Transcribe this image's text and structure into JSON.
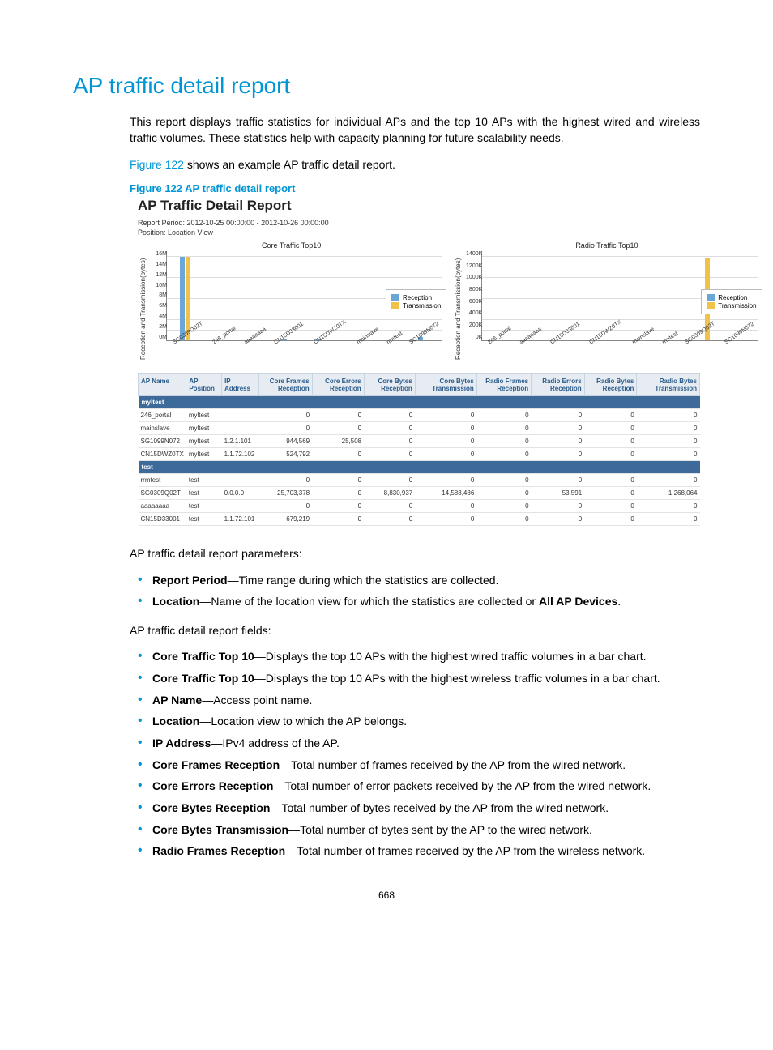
{
  "heading": "AP traffic detail report",
  "intro": "This report displays traffic statistics for individual APs and the top 10 APs with the highest wired and wireless traffic volumes. These statistics help with capacity planning for future scalability needs.",
  "figure_ref_link": "Figure 122",
  "figure_ref_tail": " shows an example AP traffic detail report.",
  "figure_caption": "Figure 122 AP traffic detail report",
  "shot": {
    "title": "AP Traffic Detail Report",
    "report_period": "Report Period: 2012-10-25 00:00:00  -  2012-10-26 00:00:00",
    "position": "Position: Location View",
    "legend_rx": "Reception",
    "legend_tx": "Transmission",
    "columns": [
      "AP Name",
      "AP Position",
      "IP Address",
      "Core Frames Reception",
      "Core Errors Reception",
      "Core Bytes Reception",
      "Core Bytes Transmission",
      "Radio Frames Reception",
      "Radio Errors Reception",
      "Radio Bytes Reception",
      "Radio Bytes Transmission"
    ],
    "groups": [
      {
        "name": "myltest",
        "rows": [
          {
            "ap": "246_portal",
            "pos": "myltest",
            "ip": "",
            "v": [
              "0",
              "0",
              "0",
              "0",
              "0",
              "0",
              "0",
              "0"
            ]
          },
          {
            "ap": "mainslave",
            "pos": "myltest",
            "ip": "",
            "v": [
              "0",
              "0",
              "0",
              "0",
              "0",
              "0",
              "0",
              "0"
            ]
          },
          {
            "ap": "SG1099N072",
            "pos": "myltest",
            "ip": "1.2.1.101",
            "v": [
              "944,569",
              "25,508",
              "0",
              "0",
              "0",
              "0",
              "0",
              "0"
            ]
          },
          {
            "ap": "CN15DWZ0TX",
            "pos": "myltest",
            "ip": "1.1.72.102",
            "v": [
              "524,792",
              "0",
              "0",
              "0",
              "0",
              "0",
              "0",
              "0"
            ]
          }
        ]
      },
      {
        "name": "test",
        "rows": [
          {
            "ap": "rrmtest",
            "pos": "test",
            "ip": "",
            "v": [
              "0",
              "0",
              "0",
              "0",
              "0",
              "0",
              "0",
              "0"
            ]
          },
          {
            "ap": "SG0309Q02T",
            "pos": "test",
            "ip": "0.0.0.0",
            "v": [
              "25,703,378",
              "0",
              "8,830,937",
              "14,588,486",
              "0",
              "53,591",
              "0",
              "1,268,064"
            ]
          },
          {
            "ap": "aaaaaaaa",
            "pos": "test",
            "ip": "",
            "v": [
              "0",
              "0",
              "0",
              "0",
              "0",
              "0",
              "0",
              "0"
            ]
          },
          {
            "ap": "CN15D33001",
            "pos": "test",
            "ip": "1.1.72.101",
            "v": [
              "679,219",
              "0",
              "0",
              "0",
              "0",
              "0",
              "0",
              "0"
            ]
          }
        ]
      }
    ]
  },
  "chart_data": [
    {
      "type": "bar",
      "title": "Core Traffic Top10",
      "ylabel": "Reception and Transmission(bytes)",
      "yticks": [
        "0M",
        "2M",
        "4M",
        "6M",
        "8M",
        "10M",
        "12M",
        "14M",
        "16M"
      ],
      "categories": [
        "SG0309Q02T",
        "246_portal",
        "aaaaaaaa",
        "CN15D33001",
        "CN15DWZ0TX",
        "mainslave",
        "rrmtest",
        "SG1099N072"
      ],
      "series": [
        {
          "name": "Reception",
          "values": [
            15,
            0,
            0,
            0.3,
            0.3,
            0,
            0,
            0.5
          ]
        },
        {
          "name": "Transmission",
          "values": [
            15,
            0,
            0,
            0,
            0,
            0,
            0,
            0
          ]
        }
      ],
      "ylim": [
        0,
        16
      ]
    },
    {
      "type": "bar",
      "title": "Radio Traffic Top10",
      "ylabel": "Reception and Transmission(bytes)",
      "yticks": [
        "0K",
        "200K",
        "400K",
        "600K",
        "800K",
        "1000K",
        "1200K",
        "1400K"
      ],
      "categories": [
        "246_portal",
        "aaaaaaaa",
        "CN15D33001",
        "CN15DWZ0TX",
        "mainslave",
        "rrmtest",
        "SG0309Q02T",
        "SG1099N072"
      ],
      "series": [
        {
          "name": "Reception",
          "values": [
            0,
            0,
            0,
            0,
            0,
            0,
            0,
            0
          ]
        },
        {
          "name": "Transmission",
          "values": [
            0,
            0,
            0,
            0,
            0,
            0,
            1300,
            0
          ]
        }
      ],
      "ylim": [
        0,
        1400
      ]
    }
  ],
  "params_intro": "AP traffic detail report parameters:",
  "params": [
    {
      "b": "Report Period",
      "t": "—Time range during which the statistics are collected."
    },
    {
      "b": "Location",
      "t": "—Name of the location view for which the statistics are collected or ",
      "b2": "All AP Devices",
      "t2": "."
    }
  ],
  "fields_intro": "AP traffic detail report fields:",
  "fields": [
    {
      "b": "Core Traffic Top 10",
      "t": "—Displays the top 10 APs with the highest wired traffic volumes in a bar chart."
    },
    {
      "b": "Core Traffic Top 10",
      "t": "—Displays the top 10 APs with the highest wireless traffic volumes in a bar chart."
    },
    {
      "b": "AP Name",
      "t": "—Access point name."
    },
    {
      "b": "Location",
      "t": "—Location view to which the AP belongs."
    },
    {
      "b": "IP Address",
      "t": "—IPv4 address of the AP."
    },
    {
      "b": "Core Frames Reception",
      "t": "—Total number of frames received by the AP from the wired network."
    },
    {
      "b": "Core Errors Reception",
      "t": "—Total number of error packets received by the AP from the wired network."
    },
    {
      "b": "Core Bytes Reception",
      "t": "—Total number of bytes received by the AP from the wired network."
    },
    {
      "b": "Core Bytes Transmission",
      "t": "—Total number of bytes sent by the AP to the wired network."
    },
    {
      "b": "Radio Frames Reception",
      "t": "—Total number of frames received by the AP from the wireless network."
    }
  ],
  "page_number": "668"
}
